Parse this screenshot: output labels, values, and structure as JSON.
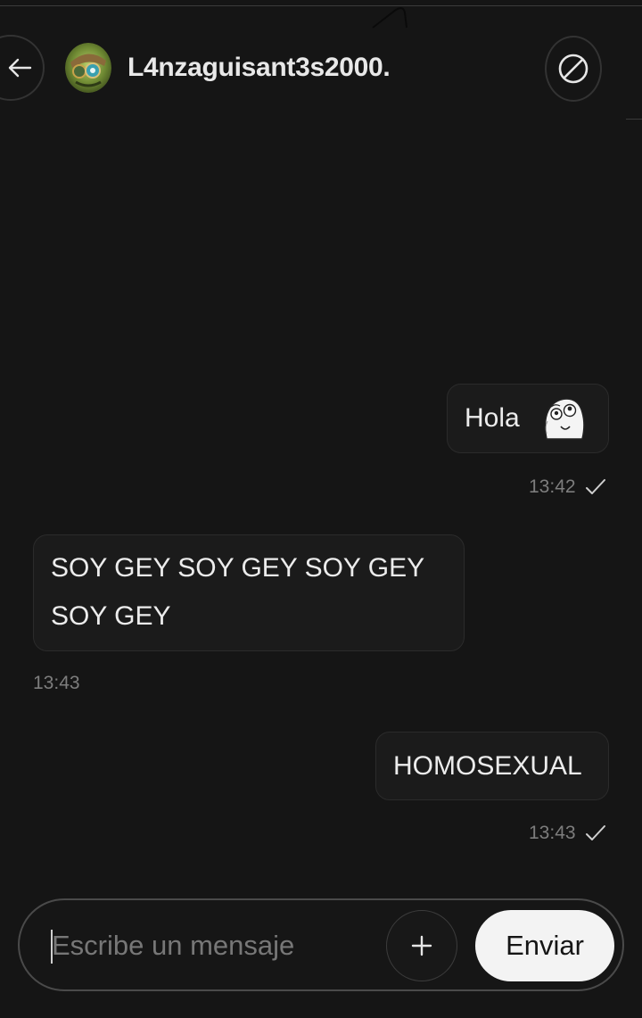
{
  "header": {
    "username": "L4nzaguisant3s2000."
  },
  "icons": {
    "back": "arrow-left-icon",
    "block": "block-icon",
    "attach": "plus-icon",
    "read": "checkmark-icon"
  },
  "messages": [
    {
      "direction": "sent",
      "text": "Hola",
      "sticker": "troll-face",
      "time": "13:42"
    },
    {
      "direction": "received",
      "text": "SOY GEY SOY GEY SOY GEY SOY GEY",
      "time": "13:43"
    },
    {
      "direction": "sent",
      "text": "HOMOSEXUAL",
      "time": "13:43"
    }
  ],
  "composer": {
    "placeholder": "Escribe un mensaje",
    "value": "",
    "send_label": "Enviar"
  },
  "colors": {
    "background": "#151515",
    "bubble": "#1b1b1b",
    "send_button": "#f3f3f3"
  }
}
